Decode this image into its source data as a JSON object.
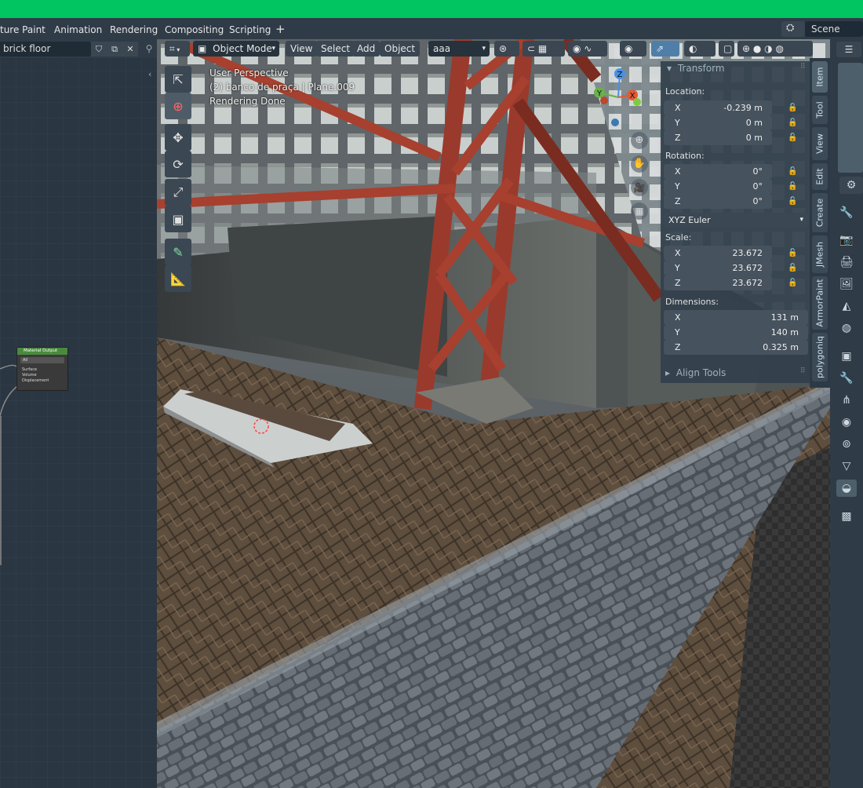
{
  "menubar": {
    "tabs": [
      "ture Paint",
      "Animation",
      "Rendering",
      "Compositing",
      "Scripting",
      "+"
    ],
    "scene": "Scene"
  },
  "node_editor": {
    "material_name": "brick floor",
    "node": {
      "title": "Material Output",
      "select": "All",
      "sockets": [
        "Surface",
        "Volume",
        "Displacement"
      ]
    }
  },
  "viewport": {
    "mode": "Object Mode",
    "menus": [
      "View",
      "Select",
      "Add",
      "Object"
    ],
    "layer_select": "aaa",
    "overlay_text": [
      "User Perspective",
      "(2) banco de praça | Plane.009",
      "Rendering Done"
    ],
    "gizmo": {
      "x": "X",
      "y": "Y",
      "z": "Z"
    }
  },
  "npanel": {
    "header": "Transform",
    "location_label": "Location:",
    "location": [
      {
        "axis": "X",
        "value": "-0.239 m"
      },
      {
        "axis": "Y",
        "value": "0 m"
      },
      {
        "axis": "Z",
        "value": "0 m"
      }
    ],
    "rotation_label": "Rotation:",
    "rotation": [
      {
        "axis": "X",
        "value": "0°"
      },
      {
        "axis": "Y",
        "value": "0°"
      },
      {
        "axis": "Z",
        "value": "0°"
      }
    ],
    "rotation_mode": "XYZ Euler",
    "scale_label": "Scale:",
    "scale": [
      {
        "axis": "X",
        "value": "23.672"
      },
      {
        "axis": "Y",
        "value": "23.672"
      },
      {
        "axis": "Z",
        "value": "23.672"
      }
    ],
    "dimensions_label": "Dimensions:",
    "dimensions": [
      {
        "axis": "X",
        "value": "131 m"
      },
      {
        "axis": "Y",
        "value": "140 m"
      },
      {
        "axis": "Z",
        "value": "0.325 m"
      }
    ],
    "align_tools": "Align Tools"
  },
  "side_tabs": [
    "Item",
    "Tool",
    "View",
    "Edit",
    "Create",
    "JMesh",
    "ArmorPaint",
    "polygoniq"
  ],
  "colors": {
    "accent_green": "#00c560",
    "header": "#2f3b47",
    "panel": "#32404c"
  }
}
